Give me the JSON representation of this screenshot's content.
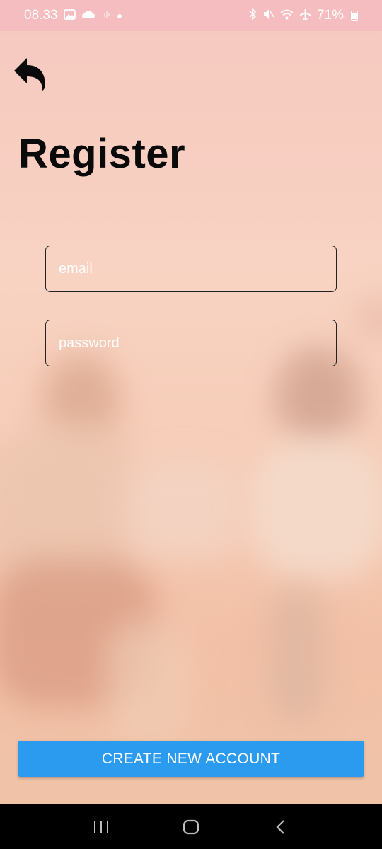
{
  "status_bar": {
    "time": "08.33",
    "battery": "71%",
    "icons": [
      "image-icon",
      "cloud-icon",
      "signal-wave-icon",
      "dot-icon",
      "bluetooth-icon",
      "mute-icon",
      "wifi-icon",
      "airplane-icon",
      "battery-icon"
    ]
  },
  "header": {
    "back_icon": "back-arrow-icon"
  },
  "page": {
    "title": "Register"
  },
  "form": {
    "email_placeholder": "email",
    "email_value": "",
    "password_placeholder": "password",
    "password_value": ""
  },
  "actions": {
    "create_label": "CREATE NEW ACCOUNT",
    "accent_color": "#2b9bf0"
  },
  "nav_bar": {
    "icons": [
      "recent-apps-icon",
      "home-icon",
      "back-icon"
    ]
  }
}
